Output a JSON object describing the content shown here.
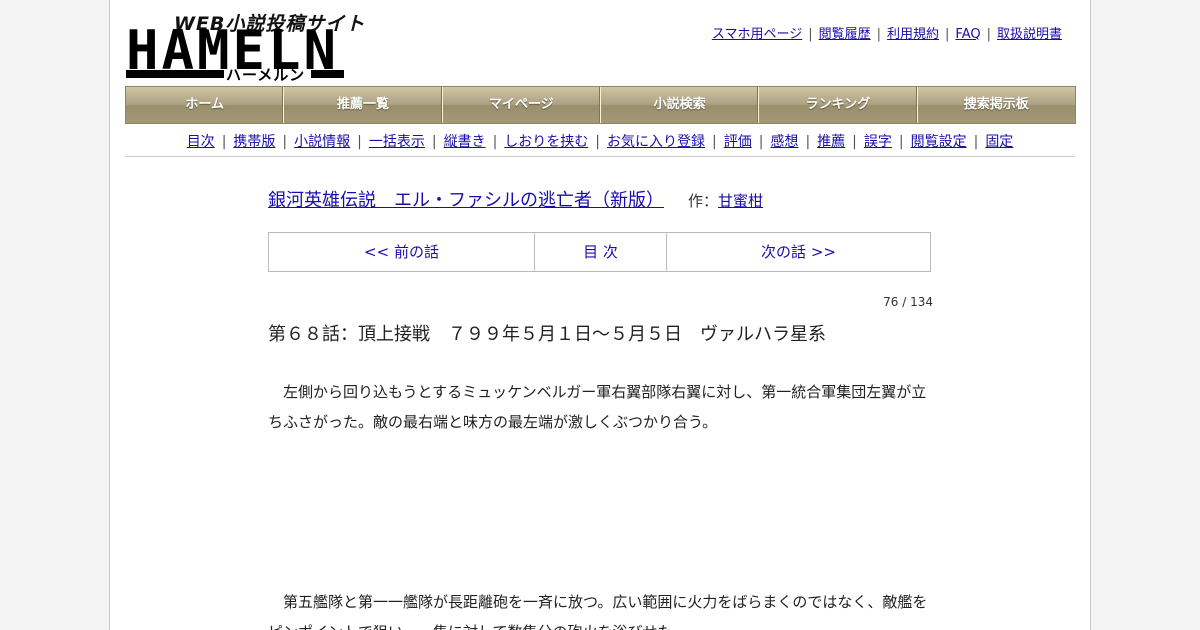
{
  "logo": {
    "tagline": "WEB小説投稿サイト",
    "wordmark": "HAMELN",
    "kana": "ハーメルン"
  },
  "top_links": [
    {
      "label": "スマホ用ページ"
    },
    {
      "label": "閲覧履歴"
    },
    {
      "label": "利用規約"
    },
    {
      "label": "FAQ"
    },
    {
      "label": "取扱説明書"
    }
  ],
  "main_nav": [
    {
      "label": "ホーム"
    },
    {
      "label": "推薦一覧"
    },
    {
      "label": "マイページ"
    },
    {
      "label": "小説検索"
    },
    {
      "label": "ランキング"
    },
    {
      "label": "捜索掲示板"
    }
  ],
  "sub_nav": [
    {
      "label": "目次"
    },
    {
      "label": "携帯版"
    },
    {
      "label": "小説情報"
    },
    {
      "label": "一括表示"
    },
    {
      "label": "縦書き"
    },
    {
      "label": "しおりを挟む"
    },
    {
      "label": "お気に入り登録"
    },
    {
      "label": "評価"
    },
    {
      "label": "感想"
    },
    {
      "label": "推薦"
    },
    {
      "label": "誤字"
    },
    {
      "label": "閲覧設定"
    },
    {
      "label": "固定"
    }
  ],
  "novel": {
    "title": "銀河英雄伝説　エル・ファシルの逃亡者（新版）",
    "author_prefix": "作：",
    "author": "甘蜜柑"
  },
  "episode_nav": {
    "prev": "<< 前の話",
    "toc": "目 次",
    "next": "次の話 >>"
  },
  "counter": "76 / 134",
  "chapter_title": "第６８話：頂上接戦　７９９年５月１日～５月５日　ヴァルハラ星系",
  "paragraphs": [
    "左側から回り込もうとするミュッケンベルガー軍右翼部隊右翼に対し、第一統合軍集団左翼が立ちふさがった。敵の最右端と味方の最左端が激しくぶつかり合う。",
    "第五艦隊と第一一艦隊が長距離砲を一斉に放つ。広い範囲に火力をばらまくのではなく、敵艦をピンポイントで狙い、一隻に対して数隻分の砲火を浴びせた。"
  ]
}
